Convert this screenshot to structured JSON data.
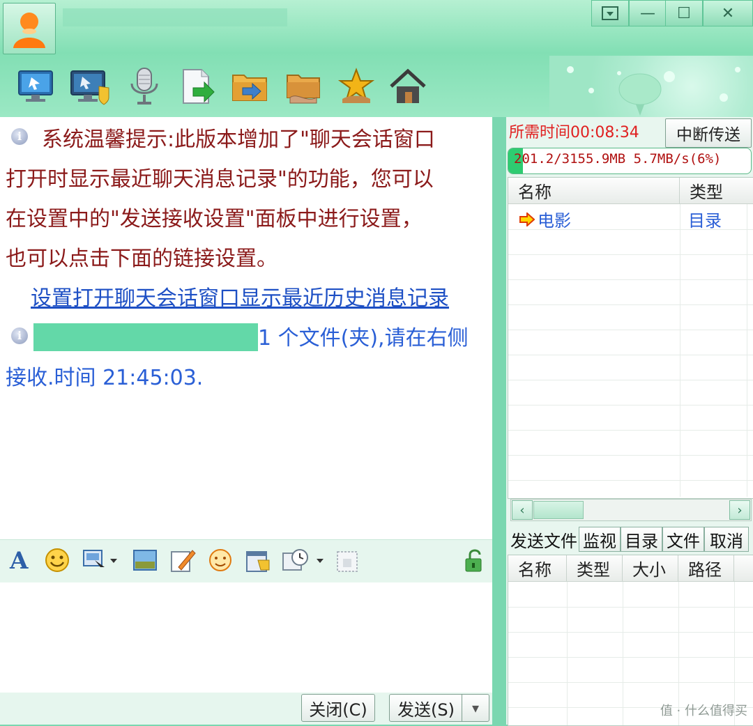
{
  "window_controls": {
    "menu_icon": "dropdown-menu-icon",
    "minimize": "—",
    "maximize": "☐",
    "close": "✕"
  },
  "toolbar": [
    {
      "name": "remote-desktop-icon"
    },
    {
      "name": "remote-assist-icon"
    },
    {
      "name": "voice-chat-icon"
    },
    {
      "name": "send-file-icon"
    },
    {
      "name": "send-folder-icon"
    },
    {
      "name": "shared-folder-icon"
    },
    {
      "name": "favorite-star-icon"
    },
    {
      "name": "home-icon"
    }
  ],
  "chat": {
    "system_tip": {
      "line1": "系统温馨提示:此版本增加了\"聊天会话窗口",
      "line2": "打开时显示最近聊天消息记录\"的功能，您可以",
      "line3": "在设置中的\"发送接收设置\"面板中进行设置，",
      "line4": "也可以点击下面的链接设置。"
    },
    "settings_link": "设置打开聊天会话窗口显示最近历史消息记录",
    "file_notice": {
      "line1": "1 个文件(夹),请在右侧",
      "line2": "接收.时间 21:45:03."
    }
  },
  "format_toolbar": [
    "font-icon",
    "emoji-icon",
    "screenshot-icon",
    "image-icon",
    "handwriting-icon",
    "magic-emoji-icon",
    "calendar-icon",
    "history-icon",
    "plugin-icon",
    "lock-icon"
  ],
  "buttons": {
    "close": "关闭(C)",
    "send": "发送(S)",
    "send_menu": "▾"
  },
  "transfer": {
    "time_needed": "所需时间00:08:34",
    "interrupt": "中断传送",
    "progress_text": "201.2/3155.9MB 5.7MB/s(6%)",
    "progress_fraction": 0.06,
    "columns": [
      "名称",
      "类型"
    ],
    "rows": [
      {
        "name": "电影",
        "type": "目录"
      }
    ]
  },
  "send_tabs": [
    "发送文件",
    "监视",
    "目录",
    "文件",
    "取消"
  ],
  "send_table": {
    "columns": [
      "名称",
      "类型",
      "大小",
      "路径"
    ]
  },
  "watermark": "值 · 什么值得买"
}
